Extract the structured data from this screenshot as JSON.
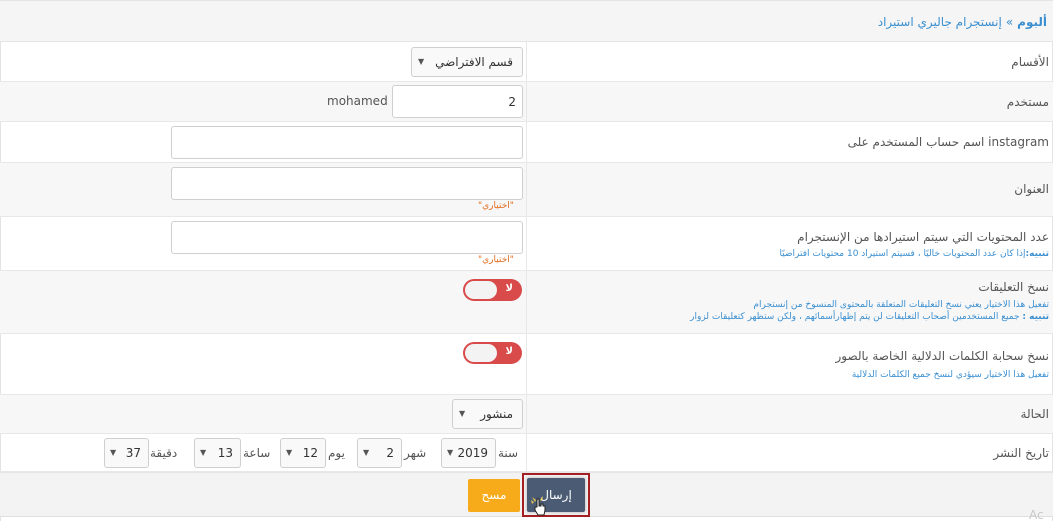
{
  "breadcrumb": {
    "root": "ألبوم",
    "separator": "»",
    "current": "إنستجرام جاليري استيراد"
  },
  "fields": {
    "sections": {
      "label": "الأقسام",
      "selected": "قسم الافتراضي"
    },
    "user": {
      "label": "مستخدم",
      "id_value": "2",
      "name": "mohamed"
    },
    "instagram_user": {
      "label": "instagram اسم حساب المستخدم على",
      "value": ""
    },
    "title": {
      "label": "العنوان",
      "value": "",
      "note": "\"اختياري\""
    },
    "count": {
      "label": "عدد المحتويات التي سيتم استيرادها من الإنستجرام",
      "hint_bold": "تنبيه:",
      "hint": "إذا كان عدد المحتويات خاليًا ، فسيتم استيراد 10 محتويات افتراضيًا",
      "value": "",
      "note": "\"اختياري\""
    },
    "copy_comments": {
      "label": "نسخ التعليقات",
      "toggle_label": "لا",
      "hint1": "تفعيل هذا الاختيار يعني نسخ التعليقات المتعلقة بالمحتوى المنسوخ من إنستجرام",
      "hint2_bold": "تنبيه :",
      "hint2": " جميع المستخدمين أصحاب التعليقات لن يتم إظهارأسمائهم ، ولكن ستظهر كتعليقات لزوار"
    },
    "copy_tags": {
      "label": "نسخ سحابة الكلمات الدلالية الخاصة بالصور",
      "toggle_label": "لا",
      "hint": "تفعيل هذا الاختيار سيؤدي لنسخ جميع الكلمات الدلالية"
    },
    "status": {
      "label": "الحالة",
      "selected": "منشور"
    },
    "publish_date": {
      "label": "تاريخ النشر",
      "year_label": "سنة",
      "year": "2019",
      "month_label": "شهر",
      "month": "2",
      "day_label": "يوم",
      "day": "12",
      "hour_label": "ساعة",
      "hour": "13",
      "minute_label": "دقيقة",
      "minute": "37"
    }
  },
  "buttons": {
    "submit": "إرسال",
    "clear": "مسح"
  },
  "watermark": "Ac"
}
